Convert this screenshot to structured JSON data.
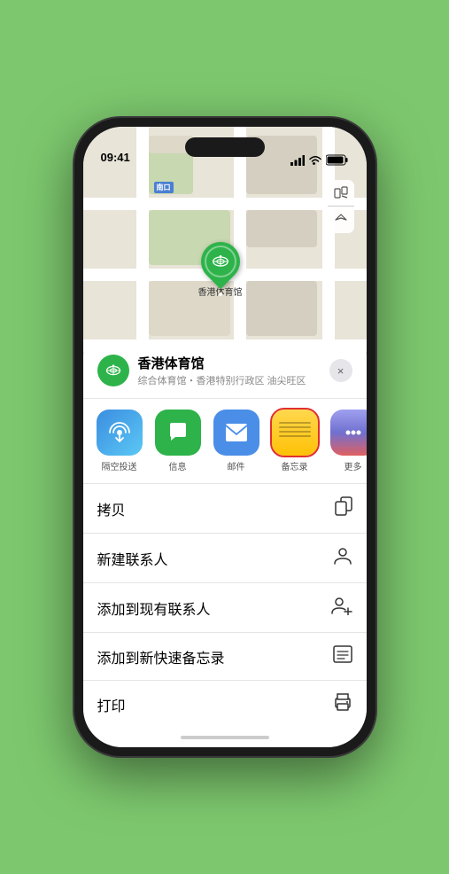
{
  "statusBar": {
    "time": "09:41",
    "locationArrow": "▶"
  },
  "mapLabels": {
    "southEntrance": {
      "box": "南口",
      "prefix": ""
    },
    "stadiumName": "香港体育馆"
  },
  "mapControls": {
    "mapViewIcon": "🗺",
    "locationIcon": "➤"
  },
  "locationCard": {
    "name": "香港体育馆",
    "subtitle": "综合体育馆・香港特别行政区 油尖旺区",
    "closeLabel": "×"
  },
  "shareRow": {
    "items": [
      {
        "id": "airdrop",
        "label": "隔空投送",
        "iconType": "airdrop"
      },
      {
        "id": "messages",
        "label": "信息",
        "iconType": "messages"
      },
      {
        "id": "mail",
        "label": "邮件",
        "iconType": "mail"
      },
      {
        "id": "notes",
        "label": "备忘录",
        "iconType": "notes",
        "selected": true
      },
      {
        "id": "more",
        "label": "更多",
        "iconType": "more"
      }
    ]
  },
  "actionRows": [
    {
      "id": "copy",
      "label": "拷贝",
      "icon": "copy"
    },
    {
      "id": "new-contact",
      "label": "新建联系人",
      "icon": "person"
    },
    {
      "id": "add-contact",
      "label": "添加到现有联系人",
      "icon": "person-add"
    },
    {
      "id": "quick-note",
      "label": "添加到新快速备忘录",
      "icon": "note"
    },
    {
      "id": "print",
      "label": "打印",
      "icon": "print"
    }
  ]
}
